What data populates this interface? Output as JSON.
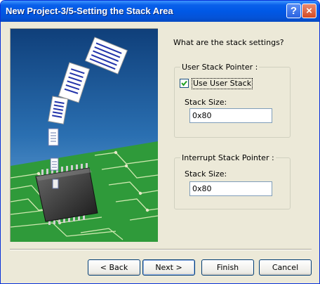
{
  "window": {
    "title": "New Project-3/5-Setting the Stack Area",
    "help_label": "?",
    "close_label": "×"
  },
  "prompt": "What are the stack settings?",
  "user_stack": {
    "group_label": "User Stack Pointer :",
    "use_checkbox_label": "Use User Stack",
    "use_checked": true,
    "size_label": "Stack Size:",
    "size_value": "0x80"
  },
  "interrupt_stack": {
    "group_label": "Interrupt Stack Pointer :",
    "size_label": "Stack Size:",
    "size_value": "0x80"
  },
  "buttons": {
    "back": "< Back",
    "next": "Next >",
    "finish": "Finish",
    "cancel": "Cancel"
  },
  "colors": {
    "titlebar": "#0453d8",
    "dialog_bg": "#ece9d8",
    "pcb_green": "#2f9a3a",
    "sky": "#2d74b4"
  }
}
